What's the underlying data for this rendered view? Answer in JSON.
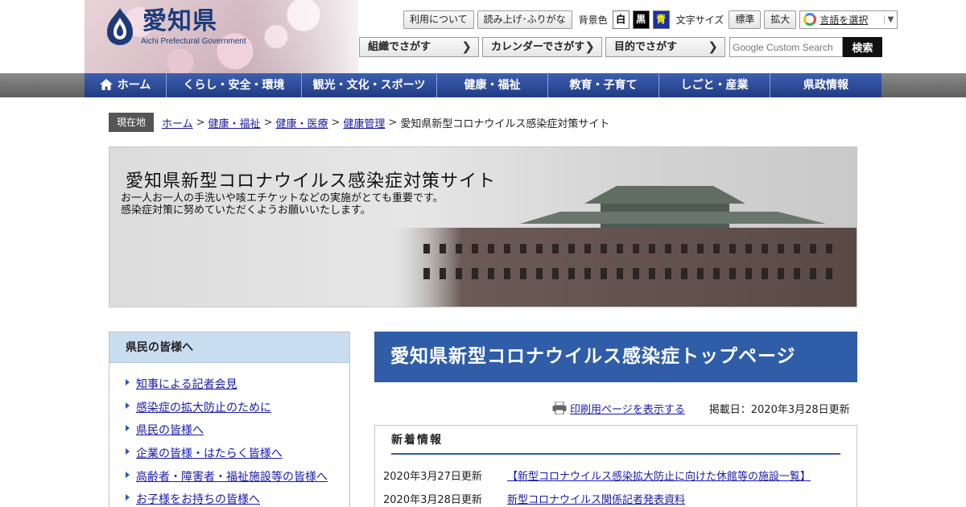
{
  "header": {
    "logo_text": "愛知県",
    "logo_sub": "Aichi Prefectural Government",
    "util": {
      "usage": "利用について",
      "readaloud": "読み上げ･ふりがな",
      "bgcolor_label": "背景色",
      "bg_white": "白",
      "bg_black": "黒",
      "bg_blue": "青",
      "fontsize_label": "文字サイズ",
      "font_standard": "標準",
      "font_large": "拡大",
      "language": "言語を選択"
    },
    "find": {
      "org": "組織でさがす",
      "calendar": "カレンダーでさがす",
      "purpose": "目的でさがす"
    },
    "search": {
      "placeholder": "Google Custom Search",
      "button": "検索"
    }
  },
  "nav": [
    {
      "label": "ホーム"
    },
    {
      "label": "くらし・安全・環境"
    },
    {
      "label": "観光・文化・スポーツ"
    },
    {
      "label": "健康・福祉"
    },
    {
      "label": "教育・子育て"
    },
    {
      "label": "しごと・産業"
    },
    {
      "label": "県政情報"
    }
  ],
  "breadcrumb": {
    "tag": "現在地",
    "links": [
      "ホーム",
      "健康・福祉",
      "健康・医療",
      "健康管理"
    ],
    "current": "愛知県新型コロナウイルス感染症対策サイト"
  },
  "banner": {
    "title": "愛知県新型コロナウイルス感染症対策サイト",
    "line1": "お一人お一人の手洗いや咳エチケットなどの実施がとても重要です。",
    "line2": "感染症対策に努めていただくようお願いいたします。"
  },
  "sidebar": {
    "heading": "県民の皆様へ",
    "items": [
      "知事による記者会見",
      "感染症の拡大防止のために",
      "県民の皆様へ",
      "企業の皆様・はたらく皆様へ",
      "高齢者・障害者・福祉施設等の皆様へ",
      "お子様をお持ちの皆様へ"
    ]
  },
  "main": {
    "title": "愛知県新型コロナウイルス感染症トップページ",
    "print_link": "印刷用ページを表示する",
    "posted": "掲載日：2020年3月28日更新",
    "news_heading": "新着情報",
    "news": [
      {
        "date": "2020年3月27日更新",
        "title": "【新型コロナウイルス感染拡大防止に向けた休館等の施設一覧】"
      },
      {
        "date": "2020年3月28日更新",
        "title": "新型コロナウイルス関係記者発表資料"
      }
    ]
  },
  "colors": {
    "nav_blue": "#2f5da8",
    "side_head": "#c9ddf0",
    "link": "#1a1aa8"
  }
}
